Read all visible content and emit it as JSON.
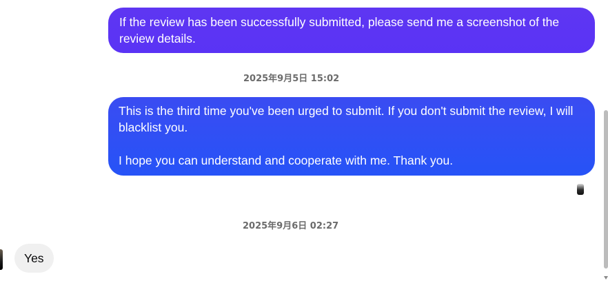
{
  "messages": {
    "outgoing_1": "If the review has been successfully submitted, please send me a screenshot of the review details.",
    "timestamp_1": "2025年9月5日 15:02",
    "outgoing_2": "This is the third time you've been urged to submit. If you don't submit the review, I will blacklist you.\n\nI hope you can understand and cooperate with me. Thank you.",
    "timestamp_2": "2025年9月6日 02:27",
    "incoming_1": "Yes"
  },
  "colors": {
    "outgoing_bubble_top": "#5e36f2",
    "outgoing_bubble_bottom": "#2653f7",
    "incoming_bubble": "#f0f0f0",
    "timestamp_text": "#6b6b6b"
  }
}
